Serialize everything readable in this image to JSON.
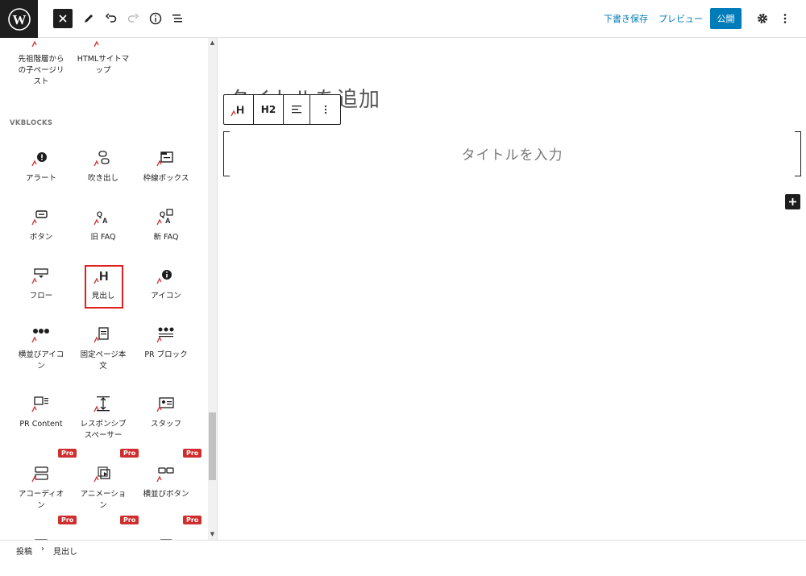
{
  "topbar": {
    "save_draft": "下書き保存",
    "preview": "プレビュー",
    "publish": "公開"
  },
  "sidebar": {
    "top_items": [
      {
        "label_lines": [
          "先祖階層から",
          "の子ページリ",
          "スト"
        ],
        "icon": "list-icon"
      },
      {
        "label_lines": [
          "HTMLサイトマ",
          "ップ"
        ],
        "icon": "list-icon"
      }
    ],
    "section_title": "VKBLOCKS",
    "blocks": [
      {
        "label_lines": [
          "アラート"
        ],
        "icon": "alert-icon",
        "pro": false
      },
      {
        "label_lines": [
          "吹き出し"
        ],
        "icon": "balloon-icon",
        "pro": false
      },
      {
        "label_lines": [
          "枠線ボックス"
        ],
        "icon": "border-box-icon",
        "pro": false
      },
      {
        "label_lines": [
          "ボタン"
        ],
        "icon": "button-icon",
        "pro": false
      },
      {
        "label_lines": [
          "旧 FAQ"
        ],
        "icon": "faq-icon",
        "pro": false
      },
      {
        "label_lines": [
          "新 FAQ"
        ],
        "icon": "faq-new-icon",
        "pro": false
      },
      {
        "label_lines": [
          "フロー"
        ],
        "icon": "flow-icon",
        "pro": false
      },
      {
        "label_lines": [
          "見出し"
        ],
        "icon": "heading-icon",
        "pro": false,
        "selected": true
      },
      {
        "label_lines": [
          "アイコン"
        ],
        "icon": "info-icon",
        "pro": false
      },
      {
        "label_lines": [
          "横並びアイコ",
          "ン"
        ],
        "icon": "icons-row-icon",
        "pro": false
      },
      {
        "label_lines": [
          "固定ページ本",
          "文"
        ],
        "icon": "page-content-icon",
        "pro": false
      },
      {
        "label_lines": [
          "PR ブロック"
        ],
        "icon": "pr-blocks-icon",
        "pro": false
      },
      {
        "label_lines": [
          "PR Content"
        ],
        "icon": "pr-content-icon",
        "pro": false
      },
      {
        "label_lines": [
          "レスポンシブ",
          "スペーサー"
        ],
        "icon": "spacer-icon",
        "pro": false
      },
      {
        "label_lines": [
          "スタッフ"
        ],
        "icon": "staff-icon",
        "pro": false
      },
      {
        "label_lines": [
          "アコーディオ",
          "ン"
        ],
        "icon": "accordion-icon",
        "pro": true
      },
      {
        "label_lines": [
          "アニメーショ",
          "ン"
        ],
        "icon": "animation-icon",
        "pro": true
      },
      {
        "label_lines": [
          "横並びボタン"
        ],
        "icon": "button-outer-icon",
        "pro": true
      },
      {
        "label_lines": [
          ""
        ],
        "icon": "card-icon",
        "pro": true
      },
      {
        "label_lines": [
          ""
        ],
        "icon": "child-page-icon",
        "pro": true
      },
      {
        "label_lines": [
          ""
        ],
        "icon": "grid-icon",
        "pro": true
      }
    ],
    "pro_label": "Pro"
  },
  "editor": {
    "title_placeholder": "タイトルを追加",
    "toolbar": {
      "level": "H2"
    },
    "heading_placeholder": "タイトルを入力"
  },
  "breadcrumb": {
    "items": [
      "投稿",
      "見出し"
    ],
    "separator": "›"
  },
  "colors": {
    "accent": "#007cba",
    "pro_badge": "#cf2e2e",
    "highlight": "#e02020",
    "dark": "#1e1e1e"
  }
}
